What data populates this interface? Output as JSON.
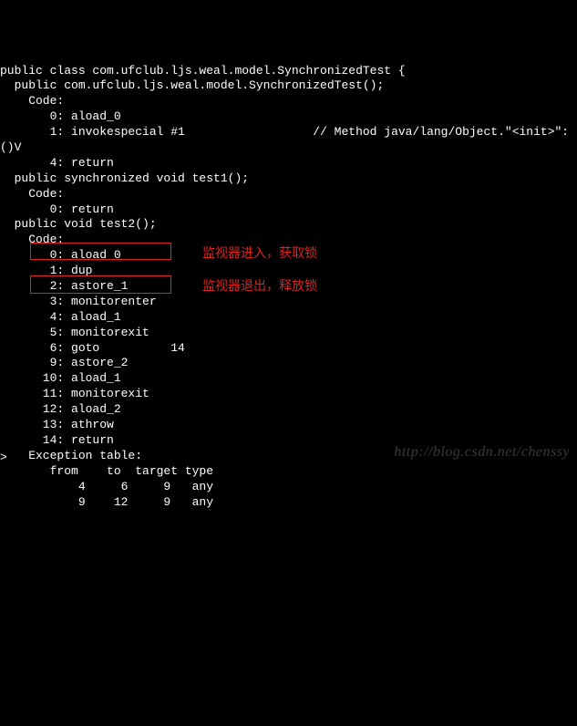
{
  "code_lines": [
    "public class com.ufclub.ljs.weal.model.SynchronizedTest {",
    "  public com.ufclub.ljs.weal.model.SynchronizedTest();",
    "    Code:",
    "       0: aload_0",
    "       1: invokespecial #1                  // Method java/lang/Object.\"<init>\":",
    "()V",
    "       4: return",
    "",
    "  public synchronized void test1();",
    "    Code:",
    "       0: return",
    "",
    "  public void test2();",
    "    Code:",
    "       0: aload_0",
    "       1: dup",
    "       2: astore_1",
    "       3: monitorenter",
    "       4: aload_1",
    "       5: monitorexit",
    "       6: goto          14",
    "       9: astore_2",
    "      10: aload_1",
    "      11: monitorexit",
    "      12: aload_2",
    "      13: athrow",
    "      14: return",
    "    Exception table:",
    "       from    to  target type",
    "           4     6     9   any",
    "           9    12     9   any"
  ],
  "annotations": {
    "enter": "监视器进入，获取锁",
    "exit": "监视器退出，释放锁"
  },
  "watermark": "http://blog.csdn.net/chenssy",
  "prompt": ">"
}
